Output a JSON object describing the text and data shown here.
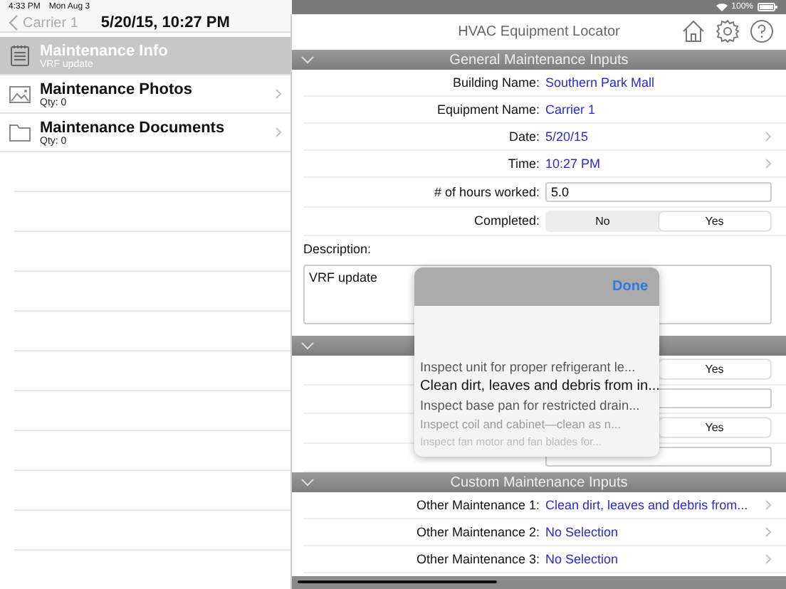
{
  "status_bar": {
    "time": "4:33 PM",
    "date": "Mon Aug 3",
    "battery": "100%"
  },
  "nav": {
    "back": "Carrier 1",
    "title": "5/20/15, 10:27 PM"
  },
  "sidebar": {
    "items": [
      {
        "kind": "notes",
        "title": "Maintenance Info",
        "subtitle": "VRF update",
        "selected": true
      },
      {
        "kind": "photos",
        "title": "Maintenance Photos",
        "subtitle": "Qty: 0",
        "selected": false
      },
      {
        "kind": "folder",
        "title": "Maintenance Documents",
        "subtitle": "Qty: 0",
        "selected": false
      }
    ]
  },
  "header": {
    "title": "HVAC Equipment Locator"
  },
  "sections": [
    {
      "title": "General Maintenance Inputs",
      "expanded": true,
      "rows": [
        {
          "kind": "value",
          "label": "Building Name:",
          "value": "Southern Park Mall",
          "disclosure": false
        },
        {
          "kind": "value",
          "label": "Equipment Name:",
          "value": "Carrier 1",
          "disclosure": false
        },
        {
          "kind": "value",
          "label": "Date:",
          "value": "5/20/15",
          "disclosure": true
        },
        {
          "kind": "value",
          "label": "Time:",
          "value": "10:27 PM",
          "disclosure": true
        },
        {
          "kind": "field",
          "label": "# of hours worked:",
          "value": "5.0"
        },
        {
          "kind": "segmented",
          "label": "Completed:",
          "options": [
            {
              "label": "No",
              "selected": false
            },
            {
              "label": "Yes",
              "selected": true
            }
          ]
        },
        {
          "kind": "textarea",
          "label": "Description:",
          "value": "VRF update"
        }
      ]
    },
    {
      "expanded": true,
      "rows": [
        {
          "kind": "segmented",
          "options": [
            {
              "label": "Yes",
              "selected": true
            }
          ]
        },
        {
          "kind": "field"
        },
        {
          "kind": "segmented",
          "options": [
            {
              "label": "Yes",
              "selected": true
            }
          ]
        },
        {
          "kind": "field"
        }
      ]
    },
    {
      "title": "Custom Maintenance Inputs",
      "expanded": true,
      "rows": [
        {
          "kind": "value",
          "label": "Other Maintenance 1:",
          "value": "Clean dirt, leaves and debris from...",
          "disclosure": true
        },
        {
          "kind": "value",
          "label": "Other Maintenance 2:",
          "value": "No Selection",
          "disclosure": true
        },
        {
          "kind": "value",
          "label": "Other Maintenance 3:",
          "value": "No Selection",
          "disclosure": true
        }
      ]
    }
  ],
  "popover": {
    "button": "Done",
    "options": [
      {
        "label": "Inspect unit for proper refrigerant le...",
        "selected": false
      },
      {
        "label": "Clean dirt, leaves and debris from in...",
        "selected": true
      },
      {
        "label": "Inspect base pan for restricted drain...",
        "selected": false
      },
      {
        "label": "Inspect coil and cabinet—clean as n...",
        "selected": false
      },
      {
        "label": "Inspect fan motor and fan blades for...",
        "selected": false
      }
    ]
  }
}
